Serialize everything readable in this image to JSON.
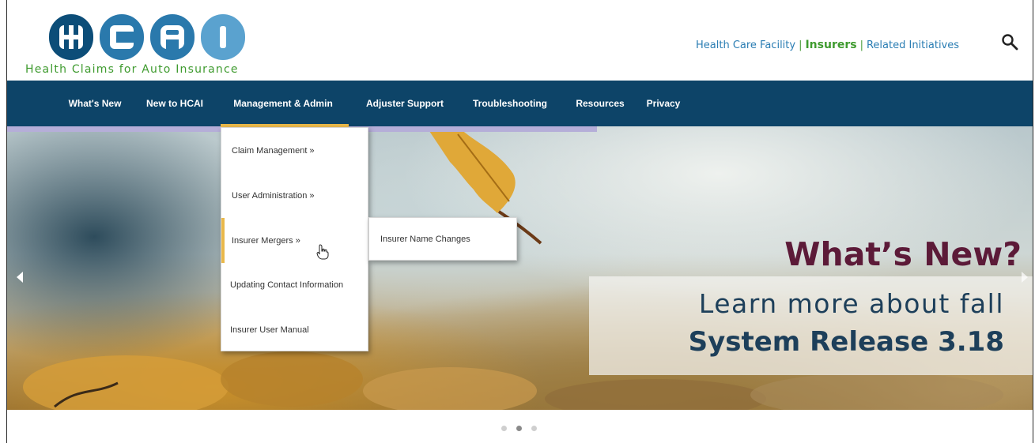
{
  "logo": {
    "letters": [
      "H",
      "C",
      "A",
      "I"
    ],
    "tagline": "Health Claims for Auto Insurance"
  },
  "top_links": {
    "items": [
      "Health Care Facility",
      "Insurers",
      "Related Initiatives"
    ],
    "separator": "|",
    "active": "Insurers",
    "search_icon": "search-icon"
  },
  "nav": {
    "items": [
      "What's New",
      "New to HCAI",
      "Management & Admin",
      "Adjuster Support",
      "Troubleshooting",
      "Resources",
      "Privacy"
    ],
    "active": "Management & Admin"
  },
  "dropdown": {
    "items": [
      "Claim Management »",
      "User Administration »",
      "Insurer Mergers »",
      "Updating Contact Information",
      "Insurer User Manual"
    ],
    "highlighted": "Insurer Mergers »",
    "submenu": [
      "Insurer Name Changes"
    ]
  },
  "hero": {
    "title": "What’s New?",
    "line1": "Learn more about fall",
    "line2": "System Release 3.18",
    "prev_icon": "chevron-left-icon",
    "next_icon": "chevron-right-icon"
  },
  "carousel": {
    "slide_count": 3,
    "active_index": 1
  },
  "colors": {
    "nav_bg": "#0d4468",
    "brand_green": "#3f9b2f",
    "brand_blue": "#2a7db3",
    "hero_title": "#5c1a38",
    "hero_text": "#1d3f5a",
    "accent_gold": "#e9b84a",
    "nav_underline": "#b5aed8"
  }
}
